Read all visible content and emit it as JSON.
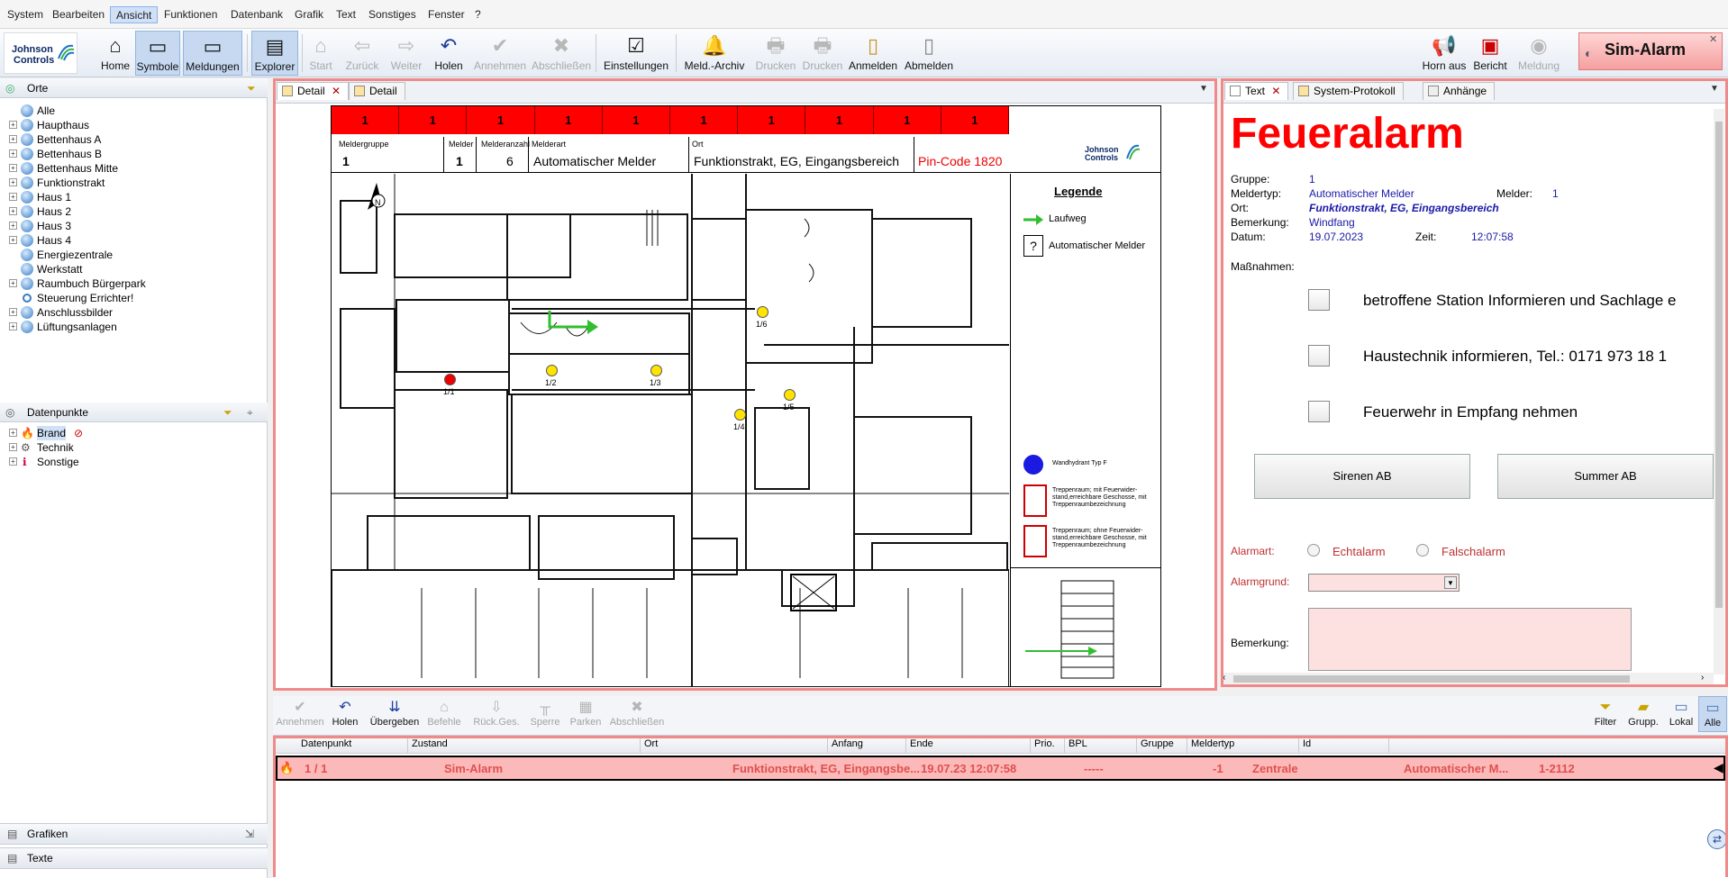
{
  "menu": [
    "System",
    "Bearbeiten",
    "Ansicht",
    "Funktionen",
    "Datenbank",
    "Grafik",
    "Text",
    "Sonstiges",
    "Fenster",
    "?"
  ],
  "menu_active": "Ansicht",
  "logo_text": [
    "Johnson",
    "Controls"
  ],
  "toolbar": {
    "home": "Home",
    "symbole": "Symbole",
    "meldungen": "Meldungen",
    "explorer": "Explorer",
    "start": "Start",
    "zurueck": "Zurück",
    "weiter": "Weiter",
    "holen": "Holen",
    "annehmen": "Annehmen",
    "abschliessen": "Abschließen",
    "einstellungen": "Einstellungen",
    "meld_archiv": "Meld.-Archiv",
    "drucken1": "Drucken",
    "drucken2": "Drucken",
    "anmelden": "Anmelden",
    "abmelden": "Abmelden",
    "horn_aus": "Horn aus",
    "bericht": "Bericht",
    "meldung": "Meldung",
    "sim_alarm": "Sim-Alarm"
  },
  "left_panel": {
    "orte_title": "Orte",
    "orte": [
      "Alle",
      "Haupthaus",
      "Bettenhaus A",
      "Bettenhaus B",
      "Bettenhaus Mitte",
      "Funktionstrakt",
      "Haus 1",
      "Haus 2",
      "Haus 3",
      "Haus 4",
      "Energiezentrale",
      "Werkstatt",
      "Raumbuch  Bürgerpark",
      "Steuerung Errichter!",
      "Anschlussbilder",
      "Lüftungsanlagen"
    ],
    "datenpunkte_title": "Datenpunkte",
    "datenpunkte": [
      "Brand",
      "Technik",
      "Sonstige"
    ],
    "grafiken": "Grafiken",
    "texte": "Texte"
  },
  "detail": {
    "tabs": [
      "Detail",
      "Detail"
    ],
    "header_cells": [
      "1",
      "1",
      "1",
      "1",
      "1",
      "1",
      "1",
      "1",
      "1",
      "1"
    ],
    "labels": {
      "meldergruppe": "Meldergruppe",
      "melder": "Melder",
      "melderanzahl": "Melderanzahl",
      "melderart": "Melderart",
      "ort": "Ort"
    },
    "values": {
      "meldergruppe": "1",
      "melder": "1",
      "melderanzahl": "6",
      "melderart": "Automatischer Melder",
      "ort": "Funktionstrakt, EG, Eingangsbereich",
      "pin": "Pin-Code 1820"
    },
    "logo": [
      "Johnson",
      "Controls"
    ],
    "legend_title": "Legende",
    "legend_laufweg": "Laufweg",
    "legend_melder": "Automatischer Melder",
    "legend_hydrant": "Wandhydrant Typ F",
    "legend_treppe1": "Treppenraum; mit Feuerwider-stand,erreichbare Geschosse, mit Treppenraumbezeichnung",
    "legend_treppe2": "Treppenraum; ohne Feuerwider-stand,erreichbare Geschosse, mit Treppenraumbezeichnung",
    "dots": [
      "1/1",
      "1/2",
      "1/3",
      "1/4",
      "1/5",
      "1/6"
    ],
    "north": "N"
  },
  "text_panel": {
    "tabs": [
      "Text",
      "System-Protokoll",
      "Anhänge"
    ],
    "title": "Feueralarm",
    "gruppe_label": "Gruppe:",
    "gruppe": "1",
    "meldertyp_label": "Meldertyp:",
    "meldertyp": "Automatischer Melder",
    "melder_label": "Melder:",
    "melder": "1",
    "ort_label": "Ort:",
    "ort": "Funktionstrakt, EG, Eingangsbereich",
    "bemerkung_label": "Bemerkung:",
    "bemerkung": "Windfang",
    "datum_label": "Datum:",
    "datum": "19.07.2023",
    "zeit_label": "Zeit:",
    "zeit": "12:07:58",
    "massnahmen": "Maßnahmen:",
    "actions": [
      "betroffene Station Informieren und Sachlage e",
      "Haustechnik  informieren, Tel.: 0171 973 18 1",
      "Feuerwehr in Empfang nehmen"
    ],
    "sirenen": "Sirenen AB",
    "summer": "Summer AB",
    "alarmart_label": "Alarmart:",
    "echtalarm": "Echtalarm",
    "falschalarm": "Falschalarm",
    "alarmgrund_label": "Alarmgrund:",
    "bemerkung2_label": "Bemerkung:"
  },
  "bottom_toolbar": {
    "annehmen": "Annehmen",
    "holen": "Holen",
    "uebergeben": "Übergeben",
    "befehle": "Befehle",
    "rueck": "Rück.Ges.",
    "sperre": "Sperre",
    "parken": "Parken",
    "abschliessen": "Abschließen",
    "filter": "Filter",
    "grupp": "Grupp.",
    "lokal": "Lokal",
    "alle": "Alle"
  },
  "table": {
    "columns": [
      "Datenpunkt",
      "Zustand",
      "Ort",
      "Anfang",
      "Ende",
      "Prio.",
      "BPL",
      "Gruppe",
      "Meldertyp",
      "Id"
    ],
    "rows": [
      {
        "datenpunkt": "1 / 1",
        "zustand": "Sim-Alarm",
        "ort": "Funktionstrakt, EG, Eingangsbe...",
        "anfang": "19.07.23  12:07:58",
        "ende": "-----",
        "prio": "-1",
        "bpl": "Zentrale",
        "gruppe": "",
        "meldertyp": "Automatischer M...",
        "id": "1-2112"
      }
    ]
  },
  "colors": {
    "alarm_red": "#ff0000",
    "border_red": "#f08a8a",
    "row_bg": "#fbb9b9",
    "link_blue": "#1a1aa8"
  }
}
